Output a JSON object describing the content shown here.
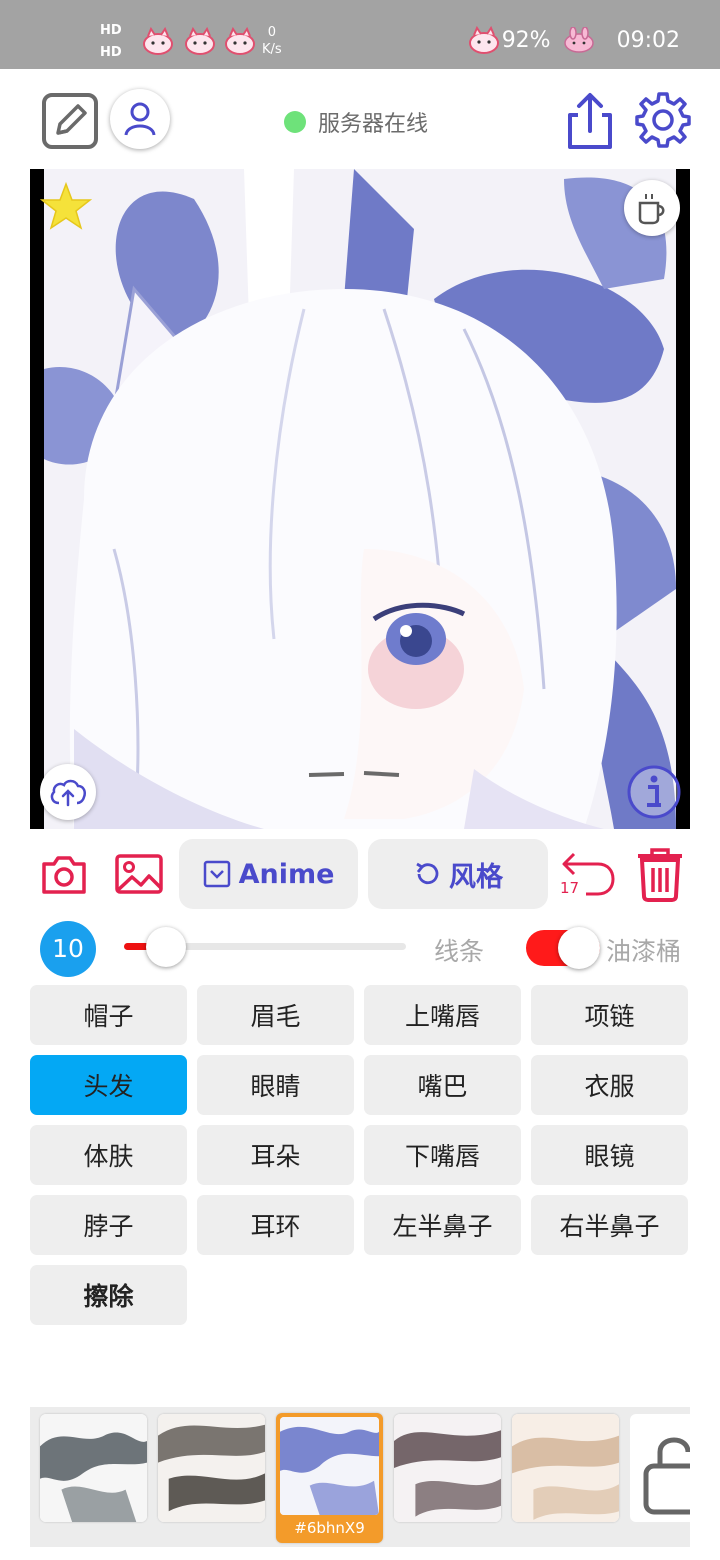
{
  "status_bar": {
    "hd1": "HD",
    "hd2": "HD",
    "net_speed": "0",
    "net_unit": "K/s",
    "battery": "92%",
    "time": "09:02"
  },
  "header": {
    "server_status": "服务器在线",
    "server_status_color": "#6ee27a"
  },
  "tools": {
    "model_label": "Anime",
    "style_label": "风格",
    "undo_count": "17"
  },
  "brush": {
    "size": "10",
    "slider_level": 0.15,
    "line_label": "线条",
    "bucket_label": "油漆桶",
    "bucket_on": true
  },
  "parts": [
    {
      "label": "帽子"
    },
    {
      "label": "眉毛"
    },
    {
      "label": "上嘴唇"
    },
    {
      "label": "项链"
    },
    {
      "label": "头发",
      "active": true
    },
    {
      "label": "眼睛"
    },
    {
      "label": "嘴巴"
    },
    {
      "label": "衣服"
    },
    {
      "label": "体肤"
    },
    {
      "label": "耳朵"
    },
    {
      "label": "下嘴唇"
    },
    {
      "label": "眼镜"
    },
    {
      "label": "脖子"
    },
    {
      "label": "耳环"
    },
    {
      "label": "左半鼻子"
    },
    {
      "label": "右半鼻子"
    },
    {
      "label": "擦除"
    }
  ],
  "styles": {
    "selected_code": "#6bhnX9"
  },
  "colors": {
    "accent": "#4a4acb",
    "danger": "#e3214f",
    "active_part": "#04a8f4",
    "selected_style": "#f39b2a"
  }
}
